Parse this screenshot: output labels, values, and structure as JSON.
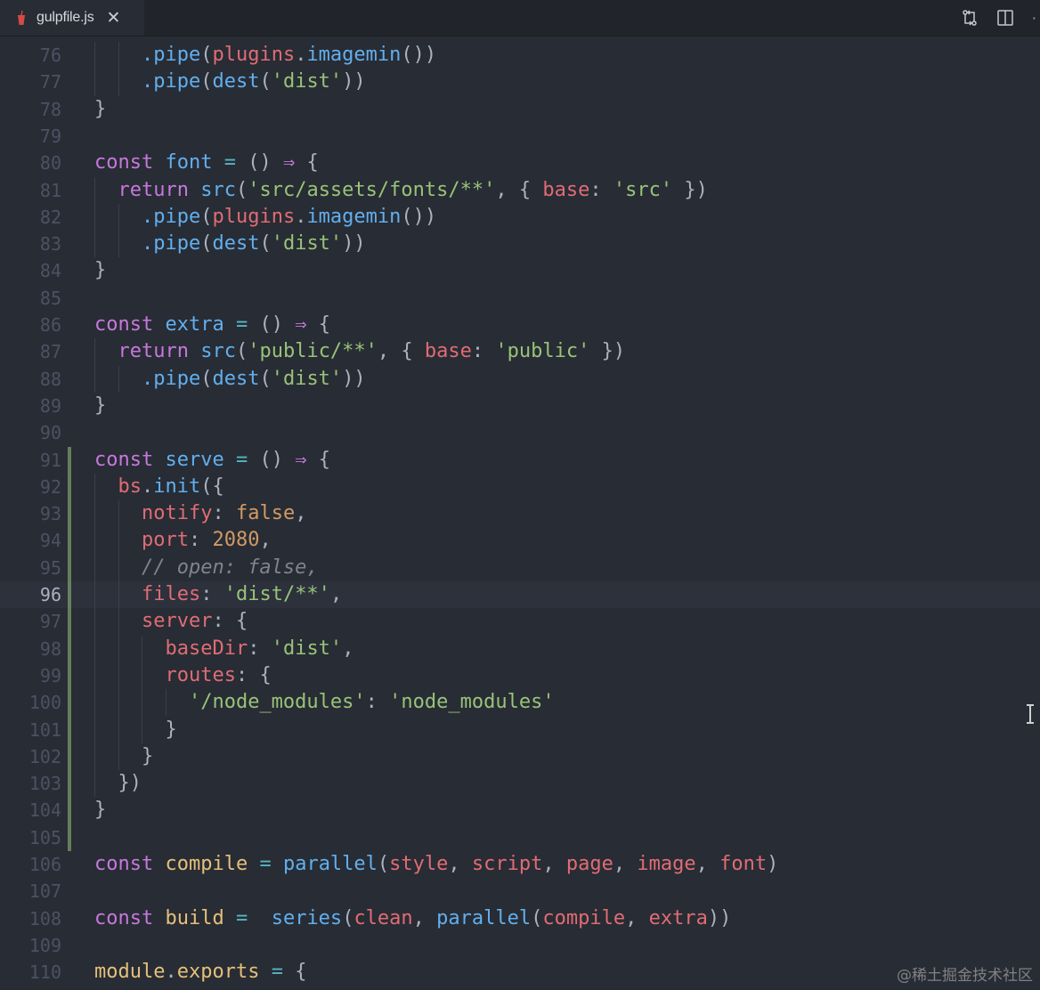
{
  "tab": {
    "filename": "gulpfile.js",
    "close": "✕",
    "file_icon": "gulp-cup-icon"
  },
  "toolbar": {
    "compare_icon": "git-compare-icon",
    "split_icon": "split-editor-icon",
    "more": "·"
  },
  "editor": {
    "current_line": 96,
    "lines": [
      {
        "n": "76",
        "tokens": [
          [
            "p",
            "    "
          ],
          [
            "f",
            ".pipe"
          ],
          [
            "p",
            "("
          ],
          [
            "v",
            "plugins"
          ],
          [
            "p",
            "."
          ],
          [
            "f",
            "imagemin"
          ],
          [
            "p",
            "())"
          ]
        ]
      },
      {
        "n": "77",
        "tokens": [
          [
            "p",
            "    "
          ],
          [
            "f",
            ".pipe"
          ],
          [
            "p",
            "("
          ],
          [
            "f",
            "dest"
          ],
          [
            "p",
            "("
          ],
          [
            "s",
            "'dist'"
          ],
          [
            "p",
            "))"
          ]
        ]
      },
      {
        "n": "78",
        "tokens": [
          [
            "p",
            "}"
          ]
        ]
      },
      {
        "n": "79",
        "tokens": []
      },
      {
        "n": "80",
        "tokens": [
          [
            "k",
            "const "
          ],
          [
            "f",
            "font"
          ],
          [
            "o",
            " = "
          ],
          [
            "p",
            "() "
          ],
          [
            "a",
            "⇒"
          ],
          [
            "p",
            " {"
          ]
        ]
      },
      {
        "n": "81",
        "tokens": [
          [
            "p",
            "  "
          ],
          [
            "k",
            "return "
          ],
          [
            "f",
            "src"
          ],
          [
            "p",
            "("
          ],
          [
            "s",
            "'src/assets/fonts/**'"
          ],
          [
            "p",
            ", { "
          ],
          [
            "v",
            "base"
          ],
          [
            "p",
            ": "
          ],
          [
            "s",
            "'src'"
          ],
          [
            "p",
            " })"
          ]
        ]
      },
      {
        "n": "82",
        "tokens": [
          [
            "p",
            "    "
          ],
          [
            "f",
            ".pipe"
          ],
          [
            "p",
            "("
          ],
          [
            "v",
            "plugins"
          ],
          [
            "p",
            "."
          ],
          [
            "f",
            "imagemin"
          ],
          [
            "p",
            "())"
          ]
        ]
      },
      {
        "n": "83",
        "tokens": [
          [
            "p",
            "    "
          ],
          [
            "f",
            ".pipe"
          ],
          [
            "p",
            "("
          ],
          [
            "f",
            "dest"
          ],
          [
            "p",
            "("
          ],
          [
            "s",
            "'dist'"
          ],
          [
            "p",
            "))"
          ]
        ]
      },
      {
        "n": "84",
        "tokens": [
          [
            "p",
            "}"
          ]
        ]
      },
      {
        "n": "85",
        "tokens": []
      },
      {
        "n": "86",
        "tokens": [
          [
            "k",
            "const "
          ],
          [
            "f",
            "extra"
          ],
          [
            "o",
            " = "
          ],
          [
            "p",
            "() "
          ],
          [
            "a",
            "⇒"
          ],
          [
            "p",
            " {"
          ]
        ]
      },
      {
        "n": "87",
        "tokens": [
          [
            "p",
            "  "
          ],
          [
            "k",
            "return "
          ],
          [
            "f",
            "src"
          ],
          [
            "p",
            "("
          ],
          [
            "s",
            "'public/**'"
          ],
          [
            "p",
            ", { "
          ],
          [
            "v",
            "base"
          ],
          [
            "p",
            ": "
          ],
          [
            "s",
            "'public'"
          ],
          [
            "p",
            " })"
          ]
        ]
      },
      {
        "n": "88",
        "tokens": [
          [
            "p",
            "    "
          ],
          [
            "f",
            ".pipe"
          ],
          [
            "p",
            "("
          ],
          [
            "f",
            "dest"
          ],
          [
            "p",
            "("
          ],
          [
            "s",
            "'dist'"
          ],
          [
            "p",
            "))"
          ]
        ]
      },
      {
        "n": "89",
        "tokens": [
          [
            "p",
            "}"
          ]
        ]
      },
      {
        "n": "90",
        "tokens": []
      },
      {
        "n": "91",
        "tokens": [
          [
            "k",
            "const "
          ],
          [
            "f",
            "serve"
          ],
          [
            "o",
            " = "
          ],
          [
            "p",
            "() "
          ],
          [
            "a",
            "⇒"
          ],
          [
            "p",
            " {"
          ]
        ]
      },
      {
        "n": "92",
        "tokens": [
          [
            "p",
            "  "
          ],
          [
            "v",
            "bs"
          ],
          [
            "p",
            "."
          ],
          [
            "f",
            "init"
          ],
          [
            "p",
            "({"
          ]
        ]
      },
      {
        "n": "93",
        "tokens": [
          [
            "p",
            "    "
          ],
          [
            "v",
            "notify"
          ],
          [
            "p",
            ": "
          ],
          [
            "n",
            "false"
          ],
          [
            "p",
            ","
          ]
        ]
      },
      {
        "n": "94",
        "tokens": [
          [
            "p",
            "    "
          ],
          [
            "v",
            "port"
          ],
          [
            "p",
            ": "
          ],
          [
            "n",
            "2080"
          ],
          [
            "p",
            ","
          ]
        ]
      },
      {
        "n": "95",
        "tokens": [
          [
            "p",
            "    "
          ],
          [
            "c",
            "// open: false,"
          ]
        ]
      },
      {
        "n": "96",
        "tokens": [
          [
            "p",
            "    "
          ],
          [
            "v",
            "files"
          ],
          [
            "p",
            ": "
          ],
          [
            "s",
            "'dist/**'"
          ],
          [
            "p",
            ","
          ]
        ]
      },
      {
        "n": "97",
        "tokens": [
          [
            "p",
            "    "
          ],
          [
            "v",
            "server"
          ],
          [
            "p",
            ": {"
          ]
        ]
      },
      {
        "n": "98",
        "tokens": [
          [
            "p",
            "      "
          ],
          [
            "v",
            "baseDir"
          ],
          [
            "p",
            ": "
          ],
          [
            "s",
            "'dist'"
          ],
          [
            "p",
            ","
          ]
        ]
      },
      {
        "n": "99",
        "tokens": [
          [
            "p",
            "      "
          ],
          [
            "v",
            "routes"
          ],
          [
            "p",
            ": {"
          ]
        ]
      },
      {
        "n": "100",
        "tokens": [
          [
            "p",
            "        "
          ],
          [
            "s",
            "'/node_modules'"
          ],
          [
            "p",
            ": "
          ],
          [
            "s",
            "'node_modules'"
          ]
        ]
      },
      {
        "n": "101",
        "tokens": [
          [
            "p",
            "      }"
          ]
        ]
      },
      {
        "n": "102",
        "tokens": [
          [
            "p",
            "    }"
          ]
        ]
      },
      {
        "n": "103",
        "tokens": [
          [
            "p",
            "  })"
          ]
        ]
      },
      {
        "n": "104",
        "tokens": [
          [
            "p",
            "}"
          ]
        ]
      },
      {
        "n": "105",
        "tokens": []
      },
      {
        "n": "106",
        "tokens": [
          [
            "k",
            "const "
          ],
          [
            "y",
            "compile"
          ],
          [
            "o",
            " = "
          ],
          [
            "f",
            "parallel"
          ],
          [
            "p",
            "("
          ],
          [
            "v",
            "style"
          ],
          [
            "p",
            ", "
          ],
          [
            "v",
            "script"
          ],
          [
            "p",
            ", "
          ],
          [
            "v",
            "page"
          ],
          [
            "p",
            ", "
          ],
          [
            "v",
            "image"
          ],
          [
            "p",
            ", "
          ],
          [
            "v",
            "font"
          ],
          [
            "p",
            ")"
          ]
        ]
      },
      {
        "n": "107",
        "tokens": []
      },
      {
        "n": "108",
        "tokens": [
          [
            "k",
            "const "
          ],
          [
            "y",
            "build"
          ],
          [
            "o",
            " =  "
          ],
          [
            "f",
            "series"
          ],
          [
            "p",
            "("
          ],
          [
            "v",
            "clean"
          ],
          [
            "p",
            ", "
          ],
          [
            "f",
            "parallel"
          ],
          [
            "p",
            "("
          ],
          [
            "v",
            "compile"
          ],
          [
            "p",
            ", "
          ],
          [
            "v",
            "extra"
          ],
          [
            "p",
            "))"
          ]
        ]
      },
      {
        "n": "109",
        "tokens": []
      },
      {
        "n": "110",
        "tokens": [
          [
            "y",
            "module"
          ],
          [
            "p",
            "."
          ],
          [
            "y",
            "exports"
          ],
          [
            "o",
            " = "
          ],
          [
            "p",
            "{"
          ]
        ]
      }
    ]
  },
  "watermark": "@稀土掘金技术社区"
}
